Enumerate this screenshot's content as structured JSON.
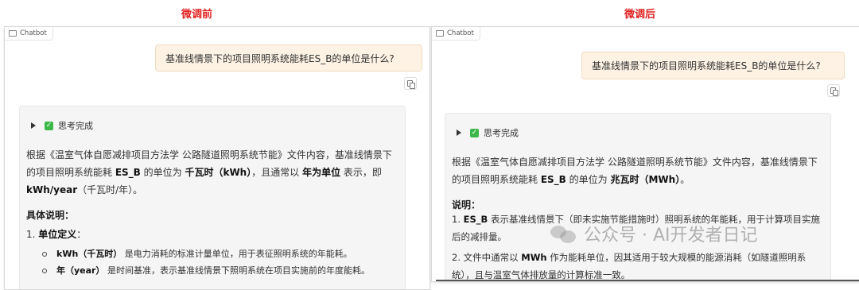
{
  "labels": {
    "before": "微调前",
    "after": "微调后"
  },
  "chatbot_label": "Chatbot",
  "question": "基准线情景下的项目照明系统能耗ES_B的单位是什么?",
  "thinking_status": "思考完成",
  "left": {
    "para1": {
      "a": "根据《温室气体自愿减排项目方法学 公路隧道照明系统节能》文件内容，基准线情景下的项目照明系统能耗 ",
      "b1": "ES_B",
      "c": " 的单位为 ",
      "b2": "千瓦时（kWh）",
      "d": "，且通常以 ",
      "b3": "年为单位",
      "e": " 表示，即 ",
      "b4": "kWh/year",
      "f": "（千瓦时/年）。"
    },
    "heading": "具体说明：",
    "item1_num": "1. ",
    "item1_title": "单位定义",
    "item1_colon": "：",
    "sub1": {
      "b1": "kWh",
      "b2": "（千瓦时）",
      "t": " 是电力消耗的标准计量单位，用于表征照明系统的年能耗。"
    },
    "sub2": {
      "b1": "年",
      "b2": "（year）",
      "t": " 是时间基准，表示基准线情景下照明系统在项目实施前的年度能耗。"
    }
  },
  "right": {
    "para1": {
      "a": "根据《温室气体自愿减排项目方法学 公路隧道照明系统节能》文件内容，基准线情景下的项目照明系统能耗 ",
      "b1": "ES_B",
      "c": " 的单位为 ",
      "b2": "兆瓦时（MWh）",
      "d": "。"
    },
    "heading": "说明：",
    "item1": {
      "num": "1. ",
      "b": "ES_B",
      "t": " 表示基准线情景下（即未实施节能措施时）照明系统的年能耗，用于计算项目实施后的减排量。"
    },
    "item2": {
      "t": "2. 文件中通常以 ",
      "b": "MWh",
      "t2": " 作为能耗单位，因其适用于较大规模的能源消耗（如隧道照明系统），且与温室气体排放量的计算标准一致。"
    }
  },
  "watermark": "公众号 · AI开发者日记",
  "colors": {
    "label_red": "#e02020",
    "user_bubble": "#fdf2e4",
    "check_green": "#3cb84a"
  }
}
